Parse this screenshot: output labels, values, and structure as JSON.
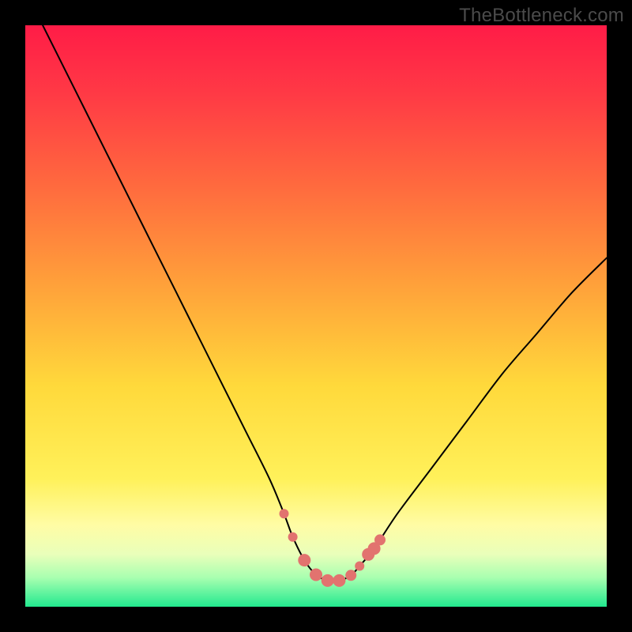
{
  "watermark": "TheBottleneck.com",
  "chart_data": {
    "type": "line",
    "title": "",
    "xlabel": "",
    "ylabel": "",
    "xlim": [
      0,
      100
    ],
    "ylim": [
      0,
      100
    ],
    "grid": false,
    "legend": false,
    "background_gradient": {
      "description": "vertical gradient top→bottom",
      "stops": [
        {
          "offset": 0.0,
          "color": "#ff1c47"
        },
        {
          "offset": 0.12,
          "color": "#ff3a45"
        },
        {
          "offset": 0.28,
          "color": "#ff6b3e"
        },
        {
          "offset": 0.45,
          "color": "#ffa23a"
        },
        {
          "offset": 0.62,
          "color": "#ffd93b"
        },
        {
          "offset": 0.78,
          "color": "#fff15a"
        },
        {
          "offset": 0.86,
          "color": "#fffca5"
        },
        {
          "offset": 0.91,
          "color": "#e9ffba"
        },
        {
          "offset": 0.95,
          "color": "#a8ffb0"
        },
        {
          "offset": 1.0,
          "color": "#22e98f"
        }
      ]
    },
    "series": [
      {
        "name": "curve",
        "color": "#000000",
        "stroke_width": 2,
        "x": [
          3,
          6,
          10,
          14,
          18,
          22,
          26,
          30,
          34,
          38,
          42,
          44.5,
          46,
          48,
          50,
          52,
          54,
          56,
          57.5,
          60,
          64,
          70,
          76,
          82,
          88,
          94,
          100
        ],
        "y": [
          100,
          94,
          86,
          78,
          70,
          62,
          54,
          46,
          38,
          30,
          22,
          16,
          12,
          8,
          5.5,
          4.5,
          4.5,
          5.4,
          7,
          10,
          16,
          24,
          32,
          40,
          47,
          54,
          60
        ]
      }
    ],
    "markers": {
      "name": "bottom-markers",
      "color": "#e2736f",
      "points": [
        {
          "x": 44.5,
          "y": 16,
          "r": 6
        },
        {
          "x": 46,
          "y": 12,
          "r": 6
        },
        {
          "x": 48,
          "y": 8,
          "r": 8
        },
        {
          "x": 50,
          "y": 5.5,
          "r": 8
        },
        {
          "x": 52,
          "y": 4.5,
          "r": 8
        },
        {
          "x": 54,
          "y": 4.5,
          "r": 8
        },
        {
          "x": 56,
          "y": 5.4,
          "r": 7
        },
        {
          "x": 57.5,
          "y": 7,
          "r": 6
        },
        {
          "x": 59,
          "y": 9,
          "r": 8
        },
        {
          "x": 60,
          "y": 10,
          "r": 8
        },
        {
          "x": 61,
          "y": 11.5,
          "r": 7
        }
      ]
    }
  }
}
